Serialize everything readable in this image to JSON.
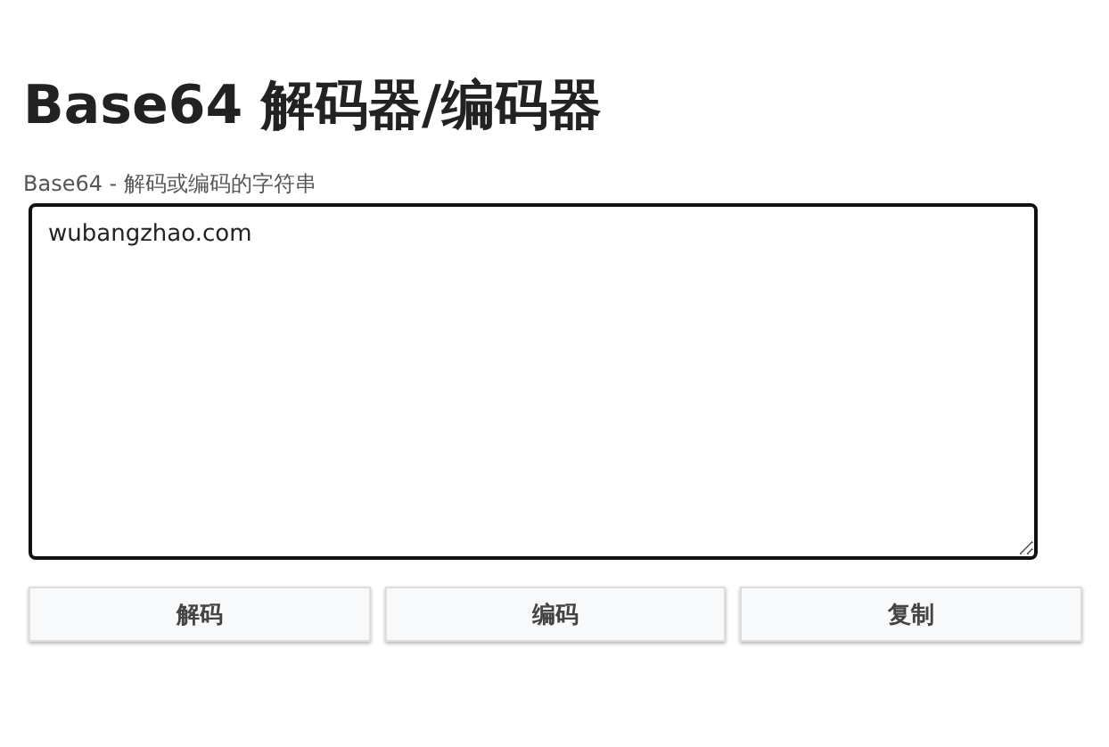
{
  "title": "Base64 解码器/编码器",
  "input": {
    "label": "Base64 - 解码或编码的字符串",
    "value": "wubangzhao.com"
  },
  "buttons": [
    "解码",
    "编码",
    "复制"
  ]
}
